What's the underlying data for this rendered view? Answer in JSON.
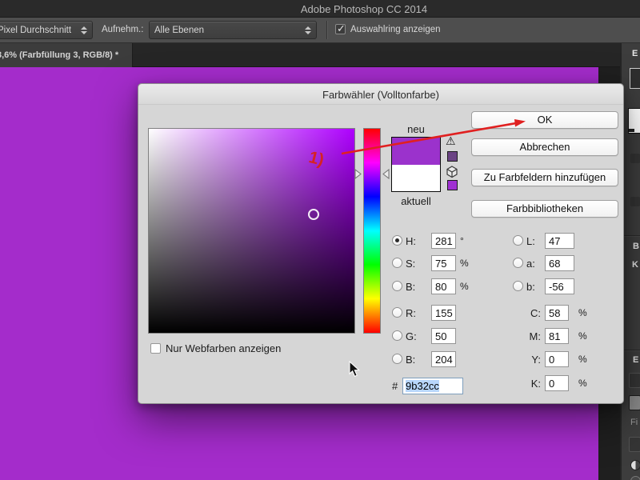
{
  "window": {
    "title": "Adobe Photoshop CC 2014"
  },
  "options_bar": {
    "tool_preset": "Pixel Durchschnitt",
    "sample_label": "Aufnehm.:",
    "sample_value": "Alle Ebenen",
    "checkbox_label": "Auswahlring anzeigen",
    "checkbox_checked": true
  },
  "document_tab": {
    "title": "3,6% (Farbfüllung 3, RGB/8) *"
  },
  "canvas": {
    "color": "#a42ccb"
  },
  "dialog": {
    "title": "Farbwähler (Volltonfarbe)",
    "buttons": {
      "ok": "OK",
      "cancel": "Abbrechen",
      "add_to_swatches": "Zu Farbfeldern hinzufügen",
      "color_libraries": "Farbbibliotheken"
    },
    "swatch": {
      "new_label": "neu",
      "current_label": "aktuell",
      "new_color": "#9b32cc",
      "current_color": "#ffffff",
      "gamut_warning_swatch": "#6b4384",
      "web_safe_swatch": "#a030d2"
    },
    "fields": {
      "h": {
        "label": "H:",
        "value": "281",
        "unit": "°",
        "selected": true
      },
      "s": {
        "label": "S:",
        "value": "75",
        "unit": "%"
      },
      "b_hsb": {
        "label": "B:",
        "value": "80",
        "unit": "%"
      },
      "r": {
        "label": "R:",
        "value": "155"
      },
      "g": {
        "label": "G:",
        "value": "50"
      },
      "b_rgb": {
        "label": "B:",
        "value": "204"
      },
      "l": {
        "label": "L:",
        "value": "47"
      },
      "a": {
        "label": "a:",
        "value": "68"
      },
      "b_lab": {
        "label": "b:",
        "value": "-56"
      },
      "c": {
        "label": "C:",
        "value": "58",
        "unit": "%"
      },
      "m": {
        "label": "M:",
        "value": "81",
        "unit": "%"
      },
      "y": {
        "label": "Y:",
        "value": "0",
        "unit": "%"
      },
      "k": {
        "label": "K:",
        "value": "0",
        "unit": "%"
      }
    },
    "hex": {
      "label": "#",
      "value": "9b32cc"
    },
    "web_colors_checkbox": {
      "label": "Nur Webfarben anzeigen",
      "checked": false
    },
    "hue_degrees": 281
  },
  "annotation": {
    "label": "1)",
    "color": "#d62222"
  },
  "right_panel": {
    "labels": [
      "E",
      "B",
      "K",
      "E",
      "Fi"
    ]
  }
}
